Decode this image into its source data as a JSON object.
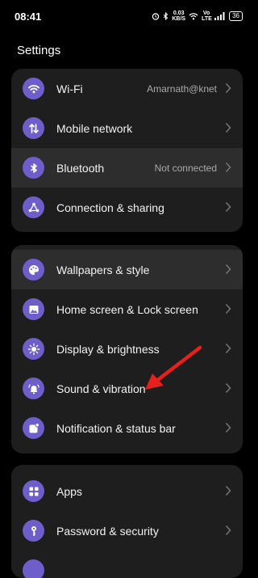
{
  "status": {
    "time": "08:41",
    "speed_value": "0.03",
    "speed_unit": "KB/S",
    "network": "Vo LTE",
    "battery": "36"
  },
  "header": {
    "title": "Settings"
  },
  "groups": [
    {
      "items": [
        {
          "label": "Wi-Fi",
          "value": "Amarnath@knet",
          "icon": "wifi-icon"
        },
        {
          "label": "Mobile network",
          "icon": "mobile-network-icon"
        },
        {
          "label": "Bluetooth",
          "value": "Not connected",
          "icon": "bluetooth-icon"
        },
        {
          "label": "Connection & sharing",
          "icon": "connection-sharing-icon"
        }
      ]
    },
    {
      "items": [
        {
          "label": "Wallpapers & style",
          "icon": "palette-icon"
        },
        {
          "label": "Home screen & Lock screen",
          "icon": "image-icon"
        },
        {
          "label": "Display & brightness",
          "icon": "brightness-icon"
        },
        {
          "label": "Sound & vibration",
          "icon": "bell-icon"
        },
        {
          "label": "Notification & status bar",
          "icon": "notification-icon"
        }
      ]
    },
    {
      "items": [
        {
          "label": "Apps",
          "icon": "apps-grid-icon"
        },
        {
          "label": "Password & security",
          "icon": "key-icon"
        }
      ]
    }
  ],
  "colors": {
    "accent": "#6e5ec9",
    "group_bg": "#1e1e1e",
    "highlight_bg": "#2d2d2d",
    "annotation_arrow": "#e8201c"
  }
}
